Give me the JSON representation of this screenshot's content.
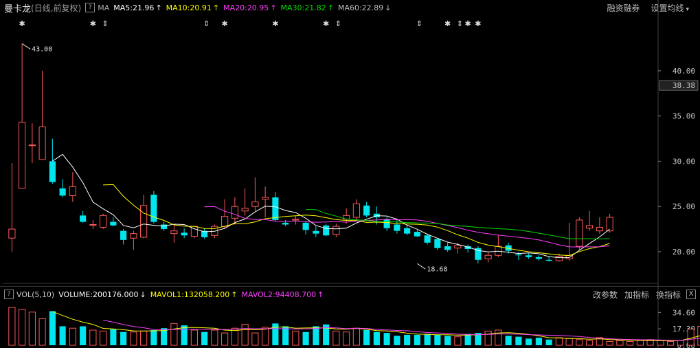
{
  "header": {
    "stock_name": "曼卡龙",
    "mode": "(日线,前复权)",
    "help": "?",
    "indicator": "MA",
    "ma5": "MA5:21.96",
    "ma10": "MA10:20.91",
    "ma20": "MA20:20.95",
    "ma30": "MA30:21.82",
    "ma60": "MA60:22.89",
    "btn_margin": "融资融券",
    "btn_ma_settings": "设置均线"
  },
  "volume_header": {
    "help": "?",
    "vol_label": "VOL(5,10)",
    "volume": "VOLUME:200176.000",
    "mavol1": "MAVOL1:132058.200",
    "mavol2": "MAVOL2:94408.700",
    "btn_params": "改参数",
    "btn_add": "加指标",
    "btn_switch": "换指标",
    "close": "X"
  },
  "colors": {
    "up": "#ff5a5a",
    "down": "#00e5ee",
    "ma5": "#ffffff",
    "ma10": "#ffff00",
    "ma20": "#ff40ff",
    "ma30": "#00dd00",
    "ma60": "#aaaaaa"
  },
  "chart_data": {
    "type": "candlestick",
    "price_axis": {
      "ticks": [
        "40.00",
        "35.00",
        "30.00",
        "25.00",
        "20.00"
      ],
      "tick_values": [
        40,
        35,
        30,
        25,
        20
      ],
      "range": [
        16.5,
        46.0
      ],
      "current_price": "38.38",
      "current_value": 38.38
    },
    "volume_axis": {
      "ticks": [
        "34.60",
        "17.30",
        "0.00"
      ],
      "tick_values": [
        34.6,
        17.3,
        0
      ],
      "range": [
        0,
        45
      ]
    },
    "annotations": [
      {
        "text": "43.00",
        "index": 1,
        "value": 43.0
      },
      {
        "text": "18.68",
        "index": 40,
        "value": 18.68
      }
    ],
    "star_marks": [
      1,
      8,
      21,
      26,
      46,
      43,
      45
    ],
    "cross_marks": [
      9,
      19,
      32,
      40,
      44
    ],
    "candles": [
      {
        "o": 21.5,
        "h": 29.8,
        "l": 20.0,
        "c": 22.5
      },
      {
        "o": 27.0,
        "h": 43.0,
        "l": 27.0,
        "c": 34.3
      },
      {
        "o": 31.8,
        "h": 34.2,
        "l": 29.8,
        "c": 31.8
      },
      {
        "o": 30.2,
        "h": 40.0,
        "l": 30.2,
        "c": 33.8
      },
      {
        "o": 30.0,
        "h": 32.5,
        "l": 27.5,
        "c": 27.7
      },
      {
        "o": 27.0,
        "h": 28.0,
        "l": 26.0,
        "c": 26.2
      },
      {
        "o": 26.2,
        "h": 28.8,
        "l": 25.5,
        "c": 27.2
      },
      {
        "o": 24.0,
        "h": 24.5,
        "l": 23.2,
        "c": 23.3
      },
      {
        "o": 23.0,
        "h": 23.5,
        "l": 22.5,
        "c": 23.0
      },
      {
        "o": 22.7,
        "h": 24.2,
        "l": 22.5,
        "c": 24.0
      },
      {
        "o": 23.3,
        "h": 23.8,
        "l": 22.8,
        "c": 22.9
      },
      {
        "o": 22.3,
        "h": 22.5,
        "l": 20.8,
        "c": 21.3
      },
      {
        "o": 21.5,
        "h": 22.3,
        "l": 20.2,
        "c": 22.0
      },
      {
        "o": 21.6,
        "h": 26.3,
        "l": 21.5,
        "c": 25.1
      },
      {
        "o": 26.3,
        "h": 26.7,
        "l": 23.1,
        "c": 23.3
      },
      {
        "o": 23.0,
        "h": 23.3,
        "l": 22.3,
        "c": 22.5
      },
      {
        "o": 22.0,
        "h": 23.0,
        "l": 21.0,
        "c": 22.3
      },
      {
        "o": 22.1,
        "h": 22.6,
        "l": 21.5,
        "c": 21.8
      },
      {
        "o": 21.7,
        "h": 22.8,
        "l": 21.5,
        "c": 22.8
      },
      {
        "o": 22.3,
        "h": 22.6,
        "l": 21.4,
        "c": 21.6
      },
      {
        "o": 21.8,
        "h": 23.0,
        "l": 21.5,
        "c": 22.8
      },
      {
        "o": 22.8,
        "h": 25.8,
        "l": 22.5,
        "c": 23.9
      },
      {
        "o": 23.7,
        "h": 26.0,
        "l": 23.0,
        "c": 25.0
      },
      {
        "o": 24.5,
        "h": 27.0,
        "l": 24.0,
        "c": 24.8
      },
      {
        "o": 25.0,
        "h": 28.2,
        "l": 24.5,
        "c": 25.5
      },
      {
        "o": 25.8,
        "h": 27.2,
        "l": 23.8,
        "c": 26.0
      },
      {
        "o": 26.0,
        "h": 26.6,
        "l": 23.3,
        "c": 23.5
      },
      {
        "o": 23.2,
        "h": 23.5,
        "l": 22.8,
        "c": 23.0
      },
      {
        "o": 23.5,
        "h": 24.0,
        "l": 23.0,
        "c": 23.6
      },
      {
        "o": 23.2,
        "h": 23.4,
        "l": 21.9,
        "c": 22.4
      },
      {
        "o": 22.3,
        "h": 22.8,
        "l": 21.6,
        "c": 22.0
      },
      {
        "o": 22.9,
        "h": 23.1,
        "l": 21.7,
        "c": 21.8
      },
      {
        "o": 21.9,
        "h": 23.1,
        "l": 21.6,
        "c": 22.8
      },
      {
        "o": 23.6,
        "h": 24.8,
        "l": 23.1,
        "c": 24.0
      },
      {
        "o": 23.8,
        "h": 25.8,
        "l": 23.5,
        "c": 25.3
      },
      {
        "o": 25.1,
        "h": 25.5,
        "l": 23.8,
        "c": 24.0
      },
      {
        "o": 24.2,
        "h": 25.0,
        "l": 23.0,
        "c": 23.8
      },
      {
        "o": 23.6,
        "h": 23.8,
        "l": 22.3,
        "c": 22.6
      }
    ],
    "volumes": [
      40,
      38,
      35,
      28,
      36,
      20,
      18,
      20,
      16,
      15,
      17,
      14,
      14,
      15,
      16,
      18,
      23,
      21,
      16,
      14,
      16,
      13,
      18,
      22,
      13,
      19,
      23,
      20,
      15,
      14,
      20,
      22,
      15,
      14,
      18,
      16,
      14,
      13,
      10,
      11,
      11,
      12,
      11,
      10,
      9,
      12,
      13,
      15,
      16,
      10,
      9,
      7,
      8,
      6,
      8,
      7,
      6,
      5,
      8,
      4,
      5,
      4,
      5,
      6,
      5,
      4,
      5,
      17,
      20,
      19
    ],
    "ma5_path": "",
    "notes": ""
  }
}
